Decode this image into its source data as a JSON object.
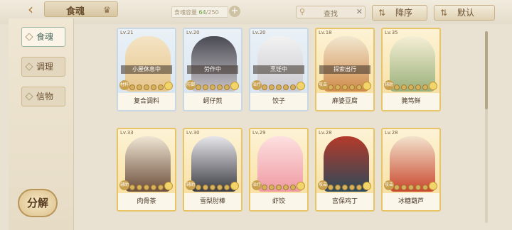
{
  "header": {
    "back_icon": "back-arrow-icon",
    "title": "食魂",
    "capacity_label": "食魂容量",
    "capacity_used": "64",
    "capacity_total": "/250",
    "search_label": "查找",
    "sort_desc_label": "降序",
    "sort_default_label": "默认"
  },
  "sidebar": {
    "items": [
      {
        "label": "食魂",
        "active": true
      },
      {
        "label": "调理",
        "active": false
      },
      {
        "label": "信物",
        "active": false
      }
    ],
    "decompose_label": "分解"
  },
  "cards": [
    {
      "level": "Lv.21",
      "name": "复合调料",
      "status": "小屋休息中",
      "role": "材料",
      "colors": [
        "#f4e4c4",
        "#e5c58c"
      ],
      "border": "blue"
    },
    {
      "level": "Lv.20",
      "name": "蚵仔煎",
      "status": "劳作中",
      "role": "防御",
      "colors": [
        "#4a4a52",
        "#c7c3c9"
      ],
      "border": "blue"
    },
    {
      "level": "Lv.20",
      "name": "饺子",
      "status": "烹饪中",
      "role": "治疗",
      "colors": [
        "#f2f2f2",
        "#c9c9cf"
      ],
      "border": "blue"
    },
    {
      "level": "Lv.18",
      "name": "麻婆豆腐",
      "status": "探索出行",
      "role": "攻击",
      "colors": [
        "#f2e7cf",
        "#cf8a4a"
      ],
      "border": "gold"
    },
    {
      "level": "Lv.35",
      "name": "腌笃鲜",
      "status": "",
      "role": "辅助",
      "colors": [
        "#f5efd5",
        "#9ab07a"
      ],
      "border": "gold"
    },
    {
      "level": "Lv.33",
      "name": "肉骨茶",
      "status": "",
      "role": "辅助",
      "colors": [
        "#efe5d3",
        "#6b4e3b"
      ],
      "border": "gold"
    },
    {
      "level": "Lv.30",
      "name": "雪梨肘棒",
      "status": "",
      "role": "辅助",
      "colors": [
        "#e6e6ea",
        "#3c3c44"
      ],
      "border": "gold"
    },
    {
      "level": "Lv.29",
      "name": "虾饺",
      "status": "",
      "role": "治疗",
      "colors": [
        "#fde0e0",
        "#ef9aa2"
      ],
      "border": "gold"
    },
    {
      "level": "Lv.28",
      "name": "宫保鸡丁",
      "status": "",
      "role": "攻击",
      "colors": [
        "#b43a2a",
        "#2d4a5a"
      ],
      "border": "gold"
    },
    {
      "level": "Lv.28",
      "name": "冰糖葫芦",
      "status": "",
      "role": "攻击",
      "colors": [
        "#f3e2cc",
        "#c9472e"
      ],
      "border": "gold"
    }
  ]
}
